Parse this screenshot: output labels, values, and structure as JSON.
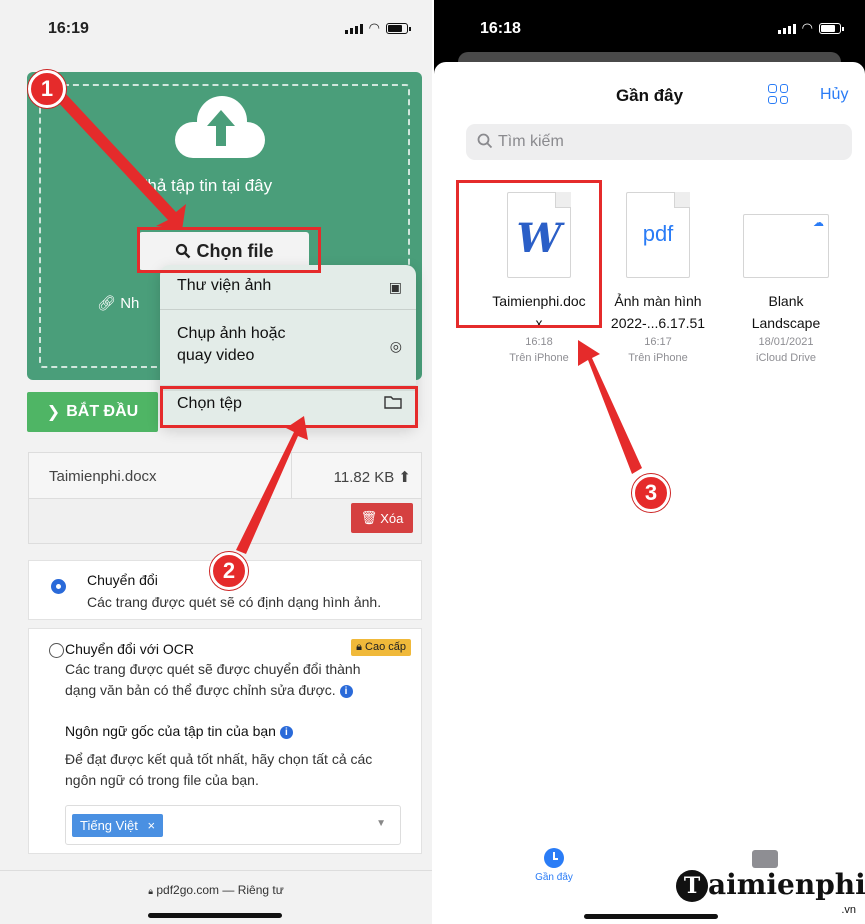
{
  "left_screen": {
    "status_time": "16:19",
    "upload": {
      "drop_text": "Thả tập tin tại đây",
      "choose_file_label": "Chọn file",
      "partial_link_text": "Nh"
    },
    "popup_menu": {
      "items": [
        {
          "label": "Thư viện ảnh",
          "icon": "photo-library-icon"
        },
        {
          "label_line1": "Chụp ảnh hoặc",
          "label_line2": "quay video",
          "icon": "camera-icon"
        },
        {
          "label": "Chọn tệp",
          "icon": "folder-icon"
        }
      ]
    },
    "start_button_label": "BẮT ĐẦU",
    "uploaded_file": {
      "name": "Taimienphi.docx",
      "size": "11.82 KB",
      "delete_label": "Xóa"
    },
    "option_convert": {
      "title": "Chuyển đổi",
      "description": "Các trang được quét sẽ có định dạng hình ảnh."
    },
    "option_ocr": {
      "title": "Chuyển đổi với OCR",
      "premium_label": "Cao cấp",
      "description_line1": "Các trang được quét sẽ được chuyển đổi thành",
      "description_line2": "dạng văn bản có thể được chỉnh sửa được.",
      "source_language_label": "Ngôn ngữ gốc của tập tin của bạn",
      "hint_line1": "Để đạt được kết quả tốt nhất, hãy chọn tất cả các",
      "hint_line2": "ngôn ngữ có trong file của bạn.",
      "selected_language": "Tiếng Việt"
    },
    "url_bar": "pdf2go.com — Riêng tư"
  },
  "right_screen": {
    "status_time": "16:18",
    "sheet_title": "Gần đây",
    "cancel_label": "Hủy",
    "search_placeholder": "Tìm kiếm",
    "files": [
      {
        "name_line1": "Taimienphi.doc",
        "name_line2": "x",
        "time": "16:18",
        "location": "Trên iPhone",
        "glyph": "W"
      },
      {
        "name_line1": "Ảnh màn hình",
        "name_line2": "2022-...6.17.51",
        "time": "16:17",
        "location": "Trên iPhone",
        "glyph": "pdf"
      },
      {
        "name_line1": "Blank",
        "name_line2": "Landscape",
        "time": "18/01/2021",
        "location": "iCloud Drive",
        "glyph": ""
      }
    ],
    "tab_recent_label": "Gần đây"
  },
  "annotations": {
    "step1": "1",
    "step2": "2",
    "step3": "3",
    "color": "#e52b2b"
  },
  "watermark": {
    "initial": "T",
    "text": "aimienphi",
    "suffix": ".vn"
  },
  "colors": {
    "upload_green": "#4a9e7a",
    "start_green": "#4fb565",
    "ios_blue": "#2a7cf6",
    "delete_red": "#d54040",
    "premium_yellow": "#f0b93a"
  }
}
